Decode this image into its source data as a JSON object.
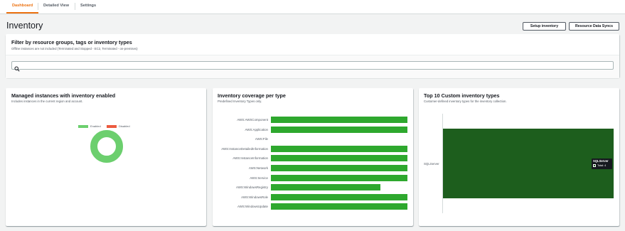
{
  "tabs": [
    {
      "label": "Dashboard",
      "active": true
    },
    {
      "label": "Detailed View",
      "active": false
    },
    {
      "label": "Settings",
      "active": false
    }
  ],
  "page": {
    "title": "Inventory"
  },
  "actions": {
    "setup_label": "Setup inventory",
    "sync_label": "Resource Data Syncs"
  },
  "filter": {
    "title": "Filter by resource groups, tags or inventory types",
    "subtitle": "Offline instances are not included (Terminated and Stopped - EC2, Terminated - on-premises)",
    "search_value": "",
    "search_icon": "search-icon"
  },
  "managed": {
    "title": "Managed instances with inventory enabled",
    "subtitle": "Includes instances in the current region and account.",
    "legend": [
      {
        "label": "Enabled",
        "color": "#6ccf6e"
      },
      {
        "label": "Disabled",
        "color": "#ec5b3f"
      }
    ],
    "chart_data": {
      "type": "pie",
      "slices": [
        {
          "label": "Enabled",
          "value": 1,
          "color": "#6ccf6e"
        },
        {
          "label": "Disabled",
          "value": 0,
          "color": "#ec5b3f"
        }
      ]
    }
  },
  "coverage": {
    "title": "Inventory coverage per type",
    "subtitle": "Predefined Inventory Types only.",
    "chart_data": {
      "type": "bar",
      "orientation": "horizontal",
      "categories": [
        "AWS:AWSComponent",
        "AWS:Application",
        "AWS:File",
        "AWS:InstanceDetailedInformation",
        "AWS:InstanceInformation",
        "AWS:Network",
        "AWS:Service",
        "AWS:WindowsRegistry",
        "AWS:WindowsRole",
        "AWS:WindowsUpdate"
      ],
      "values": [
        100,
        100,
        0,
        100,
        100,
        100,
        100,
        80,
        100,
        100
      ],
      "unit": "%",
      "xlim": [
        0,
        100
      ],
      "color": "#2ea82e"
    }
  },
  "custom": {
    "title": "Top 10 Custom inventory types",
    "subtitle": "Customer-defined inventory types for the inventory collection.",
    "chart_data": {
      "type": "bar",
      "orientation": "horizontal",
      "categories": [
        "SQLServer"
      ],
      "values": [
        4
      ],
      "xlim": [
        0,
        4
      ],
      "color": "#1d5e1d"
    },
    "tooltip": {
      "title": "SQLServer",
      "line": "Total: 4"
    }
  },
  "colors": {
    "accent": "#ec7211",
    "bar": "#2ea82e",
    "custom_bar": "#1d5e1d",
    "enabled": "#6ccf6e",
    "disabled": "#ec5b3f"
  }
}
